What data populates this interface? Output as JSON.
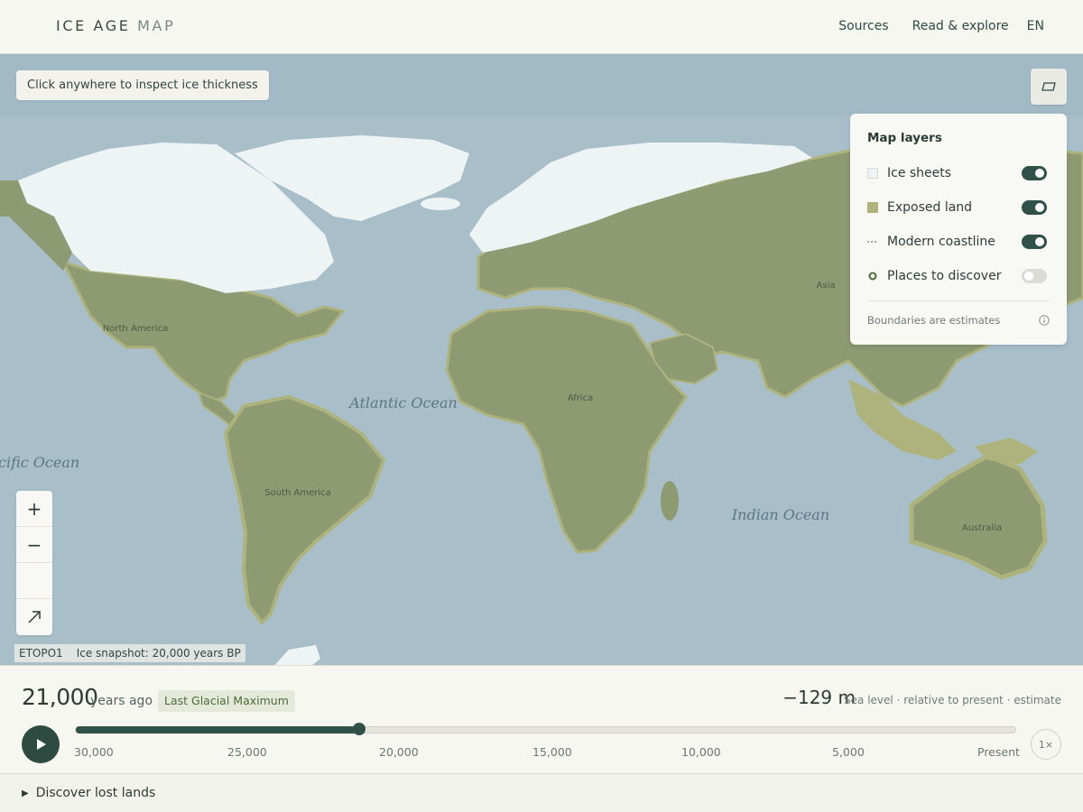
{
  "header": {
    "brand_primary": "ICE AGE",
    "brand_secondary": "MAP",
    "nav": [
      "Sources",
      "Read & explore",
      "EN"
    ]
  },
  "map": {
    "hint": "Click anywhere to inspect ice thickness",
    "oceans": [
      "Atlantic Ocean",
      "Indian Ocean",
      "cific Ocean"
    ],
    "regions": [
      "North America",
      "South America",
      "Africa",
      "Asia",
      "Australia"
    ],
    "colors": {
      "ocean": "#a8bfca",
      "land": "#8e9a72",
      "exposed": "#aeb37c",
      "ice": "#eef3f3"
    },
    "layers_button_icon": "layers-icon"
  },
  "layers_panel": {
    "title": "Map layers",
    "items": [
      {
        "label": "Ice sheets",
        "enabled": true
      },
      {
        "label": "Exposed land",
        "enabled": true
      },
      {
        "label": "Modern coastline",
        "enabled": true
      },
      {
        "label": "Places to discover",
        "enabled": false
      }
    ],
    "note": "Boundaries are estimates"
  },
  "zoom": {
    "in": "+",
    "out": "−"
  },
  "attribution": {
    "source": "ETOPO1",
    "snapshot": "Ice snapshot: 20,000 years BP"
  },
  "timeline": {
    "year": "21,000",
    "years_ago": "years ago",
    "epoch": "Last Glacial Maximum",
    "sea_level": "−129 m",
    "sea_note": "Sea level · relative to present · estimate",
    "progress": 0.302,
    "ticks": [
      "30,000",
      "25,000",
      "20,000",
      "15,000",
      "10,000",
      "5,000",
      "Present"
    ],
    "speed": "1×"
  },
  "discover": {
    "label": "Discover lost lands"
  }
}
